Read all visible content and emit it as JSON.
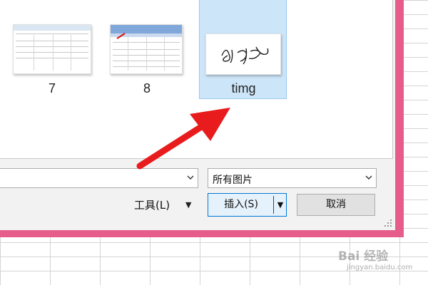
{
  "dialog": {
    "files": [
      {
        "label": "7",
        "selected": false
      },
      {
        "label": "8",
        "selected": false
      },
      {
        "label": "timg",
        "selected": true
      }
    ],
    "filename_value": "",
    "filetype_value": "所有图片",
    "tools_label": "工具(L)",
    "insert_label": "插入(S)",
    "cancel_label": "取消"
  },
  "watermark": {
    "text": "Bai 经验",
    "url": "jingyan.baidu.com"
  },
  "colors": {
    "dialog_border": "#e65d8c",
    "selection_fill": "#cde5f8",
    "arrow": "#e81c1c",
    "primary_button_border": "#0078d7"
  },
  "icons": [
    "chevron-down-icon",
    "caret-down-icon",
    "resize-grip-icon",
    "red-arrow-annotation"
  ]
}
